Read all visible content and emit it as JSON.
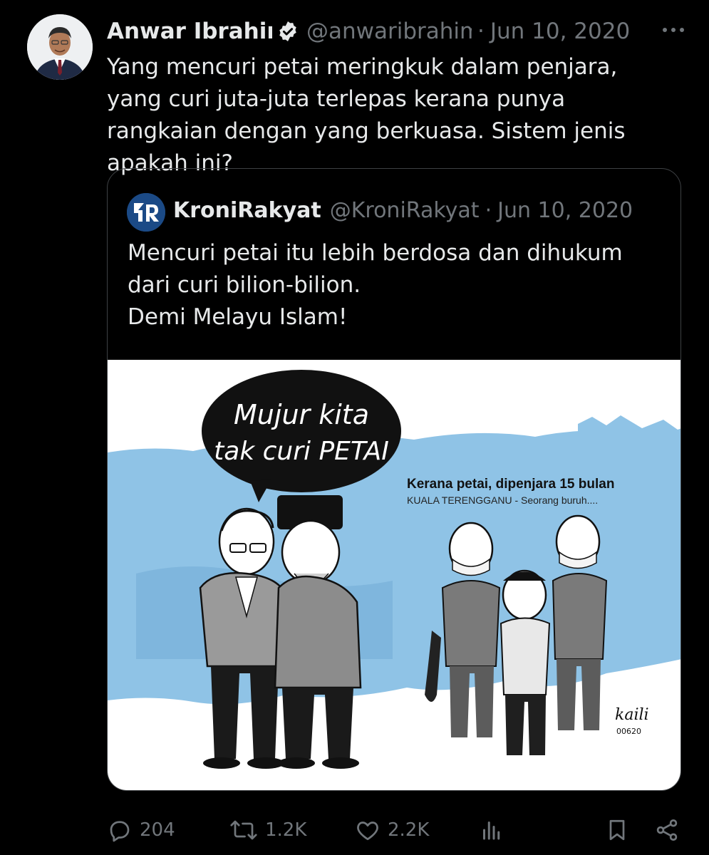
{
  "tweet": {
    "display_name": "Anwar Ibrahim",
    "handle": "@anwaribrahim",
    "separator": "·",
    "date": "Jun 10, 2020",
    "text": "Yang mencuri petai meringkuk dalam penjara, yang curi juta-juta terlepas kerana punya rangkaian dengan yang berkuasa. Sistem jenis apakah ini?",
    "verified_icon": "verified-badge-icon",
    "more_icon": "more-icon"
  },
  "quote": {
    "avatar_text": "KR",
    "display_name": "KroniRakyat",
    "handle": "@KroniRakyat",
    "separator": "·",
    "date": "Jun 10, 2020",
    "lines": [
      "Mencuri petai itu lebih berdosa dan dihukum",
      "dari curi bilion-bilion.",
      "Demi Melayu Islam!"
    ],
    "cartoon": {
      "speech_line1": "Mujur kita",
      "speech_line2": "tak curi PETAI",
      "headline": "Kerana petai, dipenjara 15 bulan",
      "subline": "KUALA TERENGGANU - Seorang buruh....",
      "signature": "kaili",
      "signature_code": "00620"
    }
  },
  "actions": {
    "replies": "204",
    "reposts": "1.2K",
    "likes": "2.2K",
    "icons": [
      "reply-icon",
      "repost-icon",
      "like-icon",
      "views-icon",
      "bookmark-icon",
      "share-icon"
    ]
  },
  "colors": {
    "background": "#000000",
    "text": "#e7e9ea",
    "muted": "#71767b",
    "verified": "#1d9bf0",
    "cartoon_blue": "#8fc3e6"
  }
}
